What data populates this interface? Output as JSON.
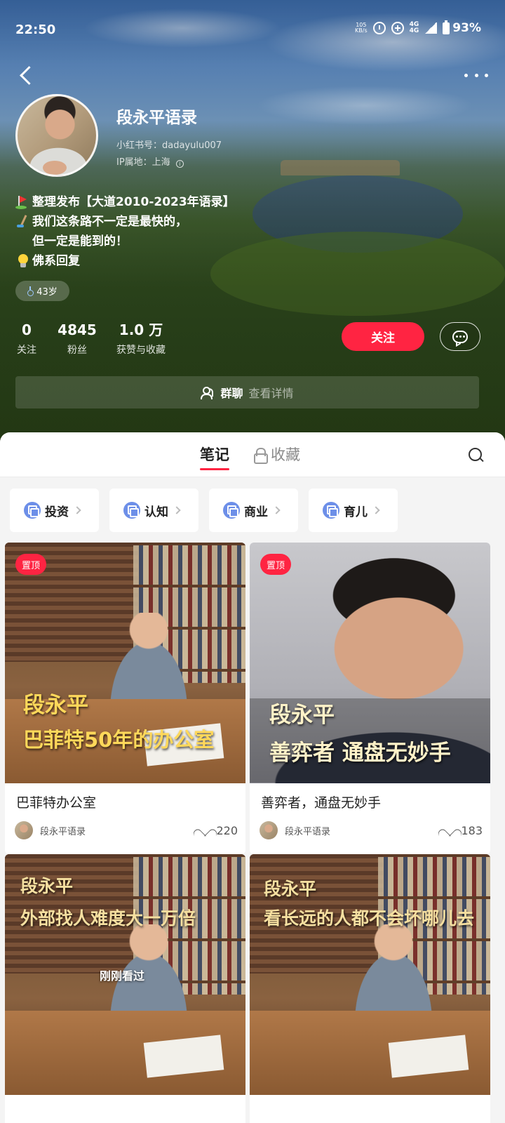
{
  "status_bar": {
    "time": "22:50",
    "net_speed_top": "105",
    "net_speed_bottom": "KB/s",
    "network": "4G",
    "network2": "4G",
    "battery": "93%"
  },
  "profile": {
    "name": "段永平语录",
    "redbook_id": "小红书号：dadayulu007",
    "ip_location": "IP属地：上海",
    "bio_lines": [
      "整理发布【大道2010-2023年语录】",
      "我们这条路不一定是最快的，",
      "但一定是能到的！",
      "佛系回复"
    ],
    "age": "43岁",
    "stats": {
      "following": {
        "value": "0",
        "label": "关注"
      },
      "fans": {
        "value": "4845",
        "label": "粉丝"
      },
      "likes": {
        "value": "1.0 万",
        "label": "获赞与收藏"
      }
    },
    "follow_label": "关注",
    "group_chat": {
      "label": "群聊",
      "detail": "查看详情"
    }
  },
  "tabs": {
    "notes": "笔记",
    "collections": "收藏"
  },
  "categories": [
    "投资",
    "认知",
    "商业",
    "育儿"
  ],
  "cards": [
    {
      "pinned": "置顶",
      "overlay_line1": "段永平",
      "overlay_line2": "巴菲特50年的办公室",
      "title": "巴菲特办公室",
      "author": "段永平语录",
      "likes": "220"
    },
    {
      "pinned": "置顶",
      "overlay_line1": "段永平",
      "overlay_line2": "善弈者 通盘无妙手",
      "title": "善弈者，通盘无妙手",
      "author": "段永平语录",
      "likes": "183"
    },
    {
      "overlay_line1": "段永平",
      "overlay_line2": "外部找人难度大一万倍",
      "seen": "刚刚看过"
    },
    {
      "overlay_line1": "段永平",
      "overlay_line2": "看长远的人都不会坏哪儿去"
    }
  ],
  "colors": {
    "accent": "#ff2442",
    "overlay_text": "#ffd85a"
  }
}
